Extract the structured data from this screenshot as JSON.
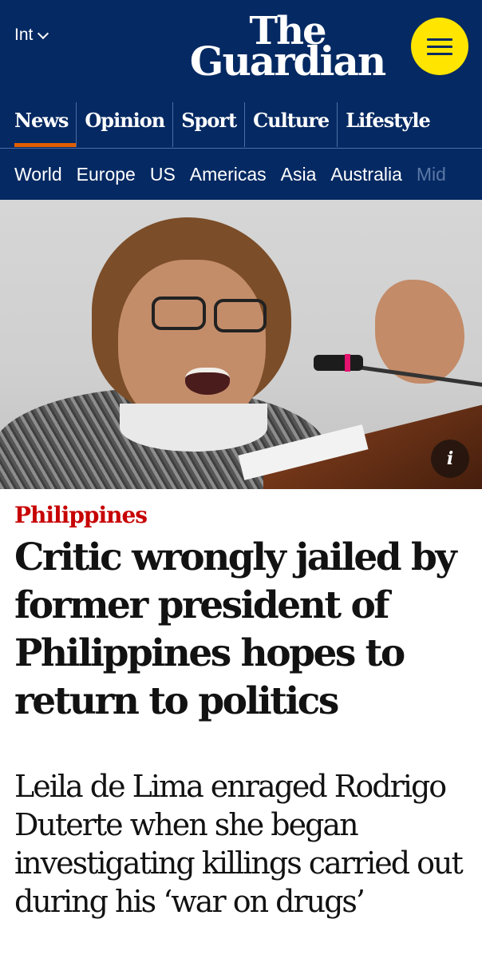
{
  "masthead": {
    "edition_label": "Int",
    "logo_line1": "The",
    "logo_line2": "Guardian",
    "brand_colors": {
      "masthead_bg": "#052962",
      "menu_button": "#ffe500",
      "active_underline": "#e05e00"
    }
  },
  "pillars": [
    {
      "label": "News",
      "active": true
    },
    {
      "label": "Opinion"
    },
    {
      "label": "Sport"
    },
    {
      "label": "Culture"
    },
    {
      "label": "Lifestyle"
    }
  ],
  "subnav": [
    "World",
    "Europe",
    "US",
    "Americas",
    "Asia",
    "Australia",
    "Mid"
  ],
  "hero_image": {
    "info_button_label": "i"
  },
  "article": {
    "kicker": "Philippines",
    "kicker_color": "#c70000",
    "headline": "Critic wrongly jailed by former president of Philippines hopes to return to politics",
    "standfirst": "Leila de Lima enraged Rodrigo Duterte when she began investigating killings carried out during his ‘war on drugs’"
  }
}
